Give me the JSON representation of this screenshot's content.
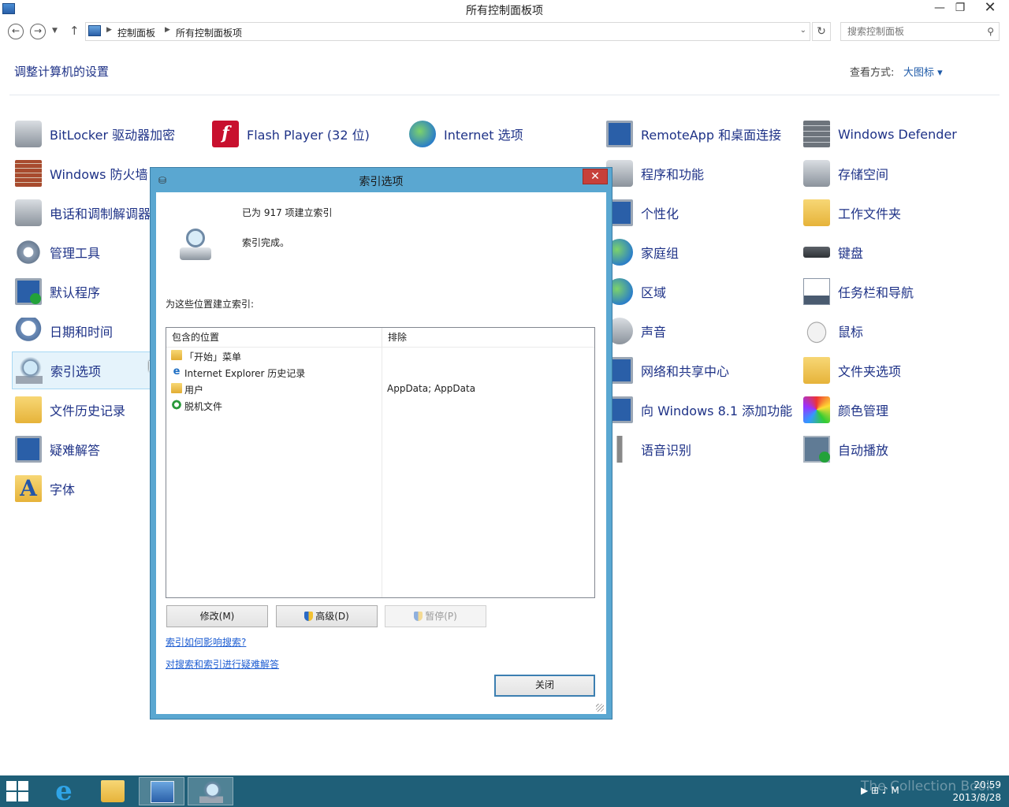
{
  "window": {
    "title": "所有控制面板项",
    "minimize": "—",
    "maximize": "❐",
    "close": "✕"
  },
  "address": {
    "crumbs": [
      "控制面板",
      "所有控制面板项"
    ],
    "search_placeholder": "搜索控制面板"
  },
  "header": {
    "title": "调整计算机的设置",
    "view_by_label": "查看方式:",
    "view_by_value": "大图标 ▾"
  },
  "items": {
    "bitlocker": "BitLocker 驱动器加密",
    "flash": "Flash Player (32 位)",
    "internet_options": "Internet 选项",
    "remoteapp": "RemoteApp 和桌面连接",
    "defender": "Windows Defender",
    "firewall": "Windows 防火墙",
    "programs": "程序和功能",
    "storage": "存储空间",
    "phone_modem": "电话和调制解调器",
    "personalize": "个性化",
    "work_folders": "工作文件夹",
    "admin_tools": "管理工具",
    "homegroup": "家庭组",
    "keyboard": "键盘",
    "default_programs": "默认程序",
    "region": "区域",
    "taskbar_nav": "任务栏和导航",
    "date_time": "日期和时间",
    "sound": "声音",
    "mouse": "鼠标",
    "indexing": "索引选项",
    "network_center": "网络和共享中心",
    "folder_options": "文件夹选项",
    "file_history": "文件历史记录",
    "add_features": "向 Windows 8.1 添加功能",
    "color_mgmt": "颜色管理",
    "troubleshoot": "疑难解答",
    "speech": "语音识别",
    "autoplay": "自动播放",
    "fonts": "字体"
  },
  "dialog": {
    "title": "索引选项",
    "close": "✕",
    "indexed_count": "已为 917 项建立索引",
    "status": "索引完成。",
    "locations_label": "为这些位置建立索引:",
    "col_included": "包含的位置",
    "col_excluded": "排除",
    "rows": [
      {
        "label": "「开始」菜单",
        "exclude": ""
      },
      {
        "label": "Internet Explorer 历史记录",
        "exclude": ""
      },
      {
        "label": "用户",
        "exclude": "AppData; AppData"
      },
      {
        "label": "脱机文件",
        "exclude": ""
      }
    ],
    "modify_button": "修改(M)",
    "advanced_button": "高级(D)",
    "pause_button": "暂停(P)",
    "link_how": "索引如何影响搜索?",
    "link_troubleshoot": "对搜索和索引进行疑难解答",
    "close_button": "关闭"
  },
  "taskbar": {
    "time": "20:59",
    "date": "2013/8/28",
    "tray_icons": "▶ ⊞ ♪ M",
    "watermark": "The Collection Book"
  },
  "colors": {
    "link": "#1e3287",
    "dialog_frame": "#5aa7d1",
    "taskbar": "#1f5f78"
  }
}
